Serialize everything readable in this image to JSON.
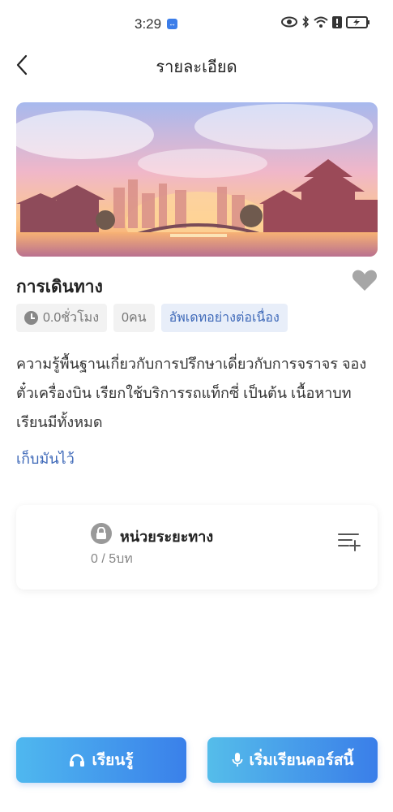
{
  "status_bar": {
    "time": "3:29"
  },
  "header": {
    "title": "รายละเอียด"
  },
  "course": {
    "title": "การเดินทาง",
    "tags": {
      "duration": "0.0ชั่วโมง",
      "learners": "0คน",
      "update": "อัพเดทอย่างต่อเนื่อง"
    },
    "description": "ความรู้พื้นฐานเกี่ยวกับการปรึกษาเดี่ยวกับการจราจร จองตั๋วเครื่องบิน เรียกใช้บริการรถแท็กซี่ เป็นต้น เนื้อหาบทเรียนมีทั้งหมด",
    "collapse_label": "เก็บมันไว้"
  },
  "unit": {
    "title": "หน่วยระยะทาง",
    "progress": "0 / 5บท"
  },
  "actions": {
    "learn_label": "เรียนรู้",
    "start_label": "เริ่มเรียนคอร์สนี้"
  },
  "colors": {
    "accent": "#3d68b8",
    "button_gradient_start": "#4fb8ef",
    "button_gradient_end": "#3a80ea"
  },
  "icons": {
    "back": "chevron-left-icon",
    "favorite": "heart-icon",
    "clock": "clock-icon",
    "lock": "lock-icon",
    "playlist_add": "playlist-add-icon",
    "headphones": "headphones-icon",
    "microphone": "microphone-icon"
  }
}
